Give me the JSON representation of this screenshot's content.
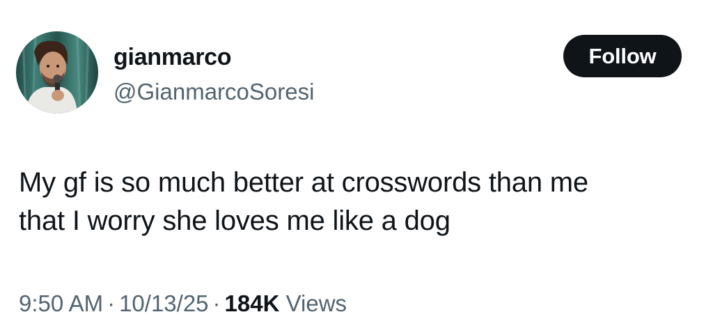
{
  "user": {
    "display_name": "gianmarco",
    "handle": "@GianmarcoSoresi",
    "avatar_icon": "user-avatar-photo"
  },
  "follow_button": {
    "label": "Follow",
    "color_bg": "#0f1419",
    "color_text": "#ffffff"
  },
  "tweet": {
    "text_lines": [
      "My gf is so much better at crosswords than me",
      "that I worry she loves me like a dog"
    ]
  },
  "meta": {
    "time": "9:50 AM",
    "separator": "·",
    "date": "10/13/25",
    "views_count": "184K",
    "views_label": "Views"
  },
  "colors": {
    "primary_text": "#0f1419",
    "secondary_text": "#536471",
    "background": "#ffffff"
  }
}
